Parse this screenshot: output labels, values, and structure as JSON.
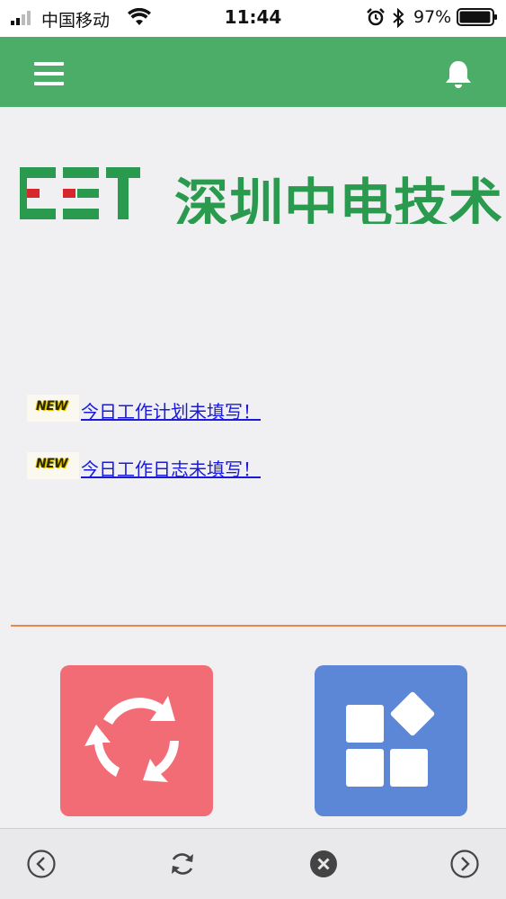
{
  "status_bar": {
    "carrier": "中国移动",
    "time": "11:44",
    "battery_percent": "97%",
    "battery_level": 0.97
  },
  "header": {
    "menu_icon": "hamburger-menu-icon",
    "bell_icon": "bell-icon",
    "background": "#4cad68"
  },
  "logo": {
    "mark": "CET",
    "company_name": "深圳中电技术"
  },
  "notices": [
    {
      "badge": "NEW",
      "text": "今日工作计划未填写！"
    },
    {
      "badge": "NEW",
      "text": "今日工作日志未填写！"
    }
  ],
  "tiles": [
    {
      "icon": "refresh-cycle-icon",
      "color": "#f26c75"
    },
    {
      "icon": "apps-grid-icon",
      "color": "#5b87d6"
    }
  ],
  "browser_bar": {
    "back_icon": "back-arrow-icon",
    "refresh_icon": "refresh-icon",
    "close_icon": "close-icon",
    "forward_icon": "forward-arrow-icon"
  }
}
